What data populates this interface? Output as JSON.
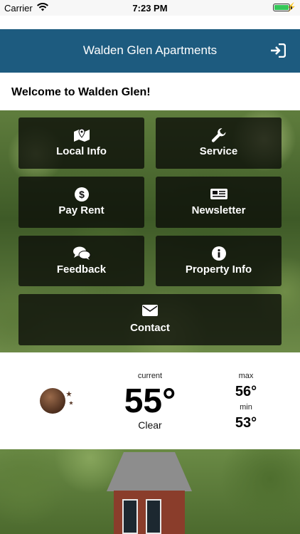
{
  "status_bar": {
    "carrier": "Carrier",
    "time": "7:23 PM"
  },
  "nav": {
    "title": "Walden Glen Apartments",
    "action_icon": "login-icon"
  },
  "welcome": "Welcome to Walden Glen!",
  "tiles": [
    {
      "label": "Local Info",
      "icon": "map-marker-icon"
    },
    {
      "label": "Service",
      "icon": "wrench-icon"
    },
    {
      "label": "Pay Rent",
      "icon": "dollar-icon"
    },
    {
      "label": "Newsletter",
      "icon": "newspaper-icon"
    },
    {
      "label": "Feedback",
      "icon": "comments-icon"
    },
    {
      "label": "Property Info",
      "icon": "info-icon"
    },
    {
      "label": "Contact",
      "icon": "envelope-icon"
    }
  ],
  "weather": {
    "current_label": "current",
    "temp": "55°",
    "condition": "Clear",
    "max_label": "max",
    "max": "56°",
    "min_label": "min",
    "min": "53°",
    "icon": "moon-stars-icon"
  },
  "colors": {
    "nav_bg": "#1d5b7f",
    "tile_bg": "#0a0c08",
    "battery": "#34c759"
  }
}
